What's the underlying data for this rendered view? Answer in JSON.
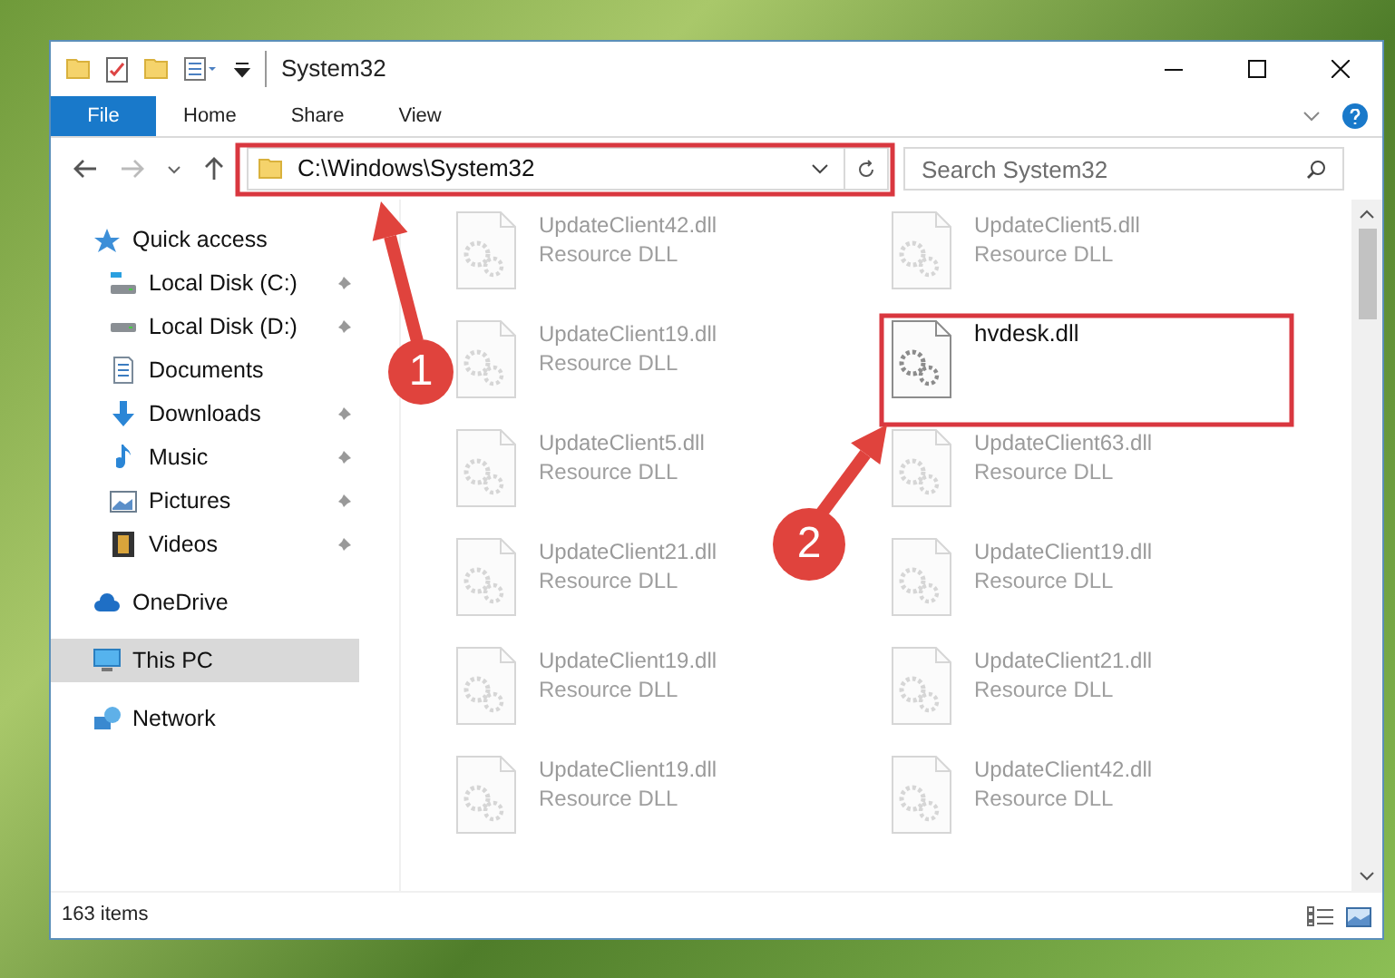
{
  "window": {
    "title": "System32"
  },
  "ribbon_tabs": [
    {
      "label": "File",
      "kind": "file",
      "selected": false
    },
    {
      "label": "Home",
      "kind": "tab",
      "selected": false
    },
    {
      "label": "Share",
      "kind": "tab",
      "selected": false
    },
    {
      "label": "View",
      "kind": "tab",
      "selected": false
    }
  ],
  "address_bar": {
    "path": "C:\\Windows\\System32"
  },
  "search": {
    "placeholder": "Search System32"
  },
  "sidebar": {
    "items": [
      {
        "label": "Quick access",
        "selected": false,
        "children": [
          {
            "label": "Local Disk (C:)",
            "pinned": true,
            "selected": false
          },
          {
            "label": "Local Disk (D:)",
            "pinned": true,
            "selected": false
          },
          {
            "label": "Documents",
            "pinned": false,
            "selected": false
          },
          {
            "label": "Downloads",
            "pinned": true,
            "selected": false
          },
          {
            "label": "Music",
            "pinned": true,
            "selected": false
          },
          {
            "label": "Pictures",
            "pinned": true,
            "selected": false
          },
          {
            "label": "Videos",
            "pinned": true,
            "selected": false
          }
        ]
      },
      {
        "label": "OneDrive",
        "selected": false
      },
      {
        "label": "This PC",
        "selected": true
      },
      {
        "label": "Network",
        "selected": false
      }
    ]
  },
  "files": [
    {
      "name": "UpdateClient42.dll",
      "type": "Resource DLL",
      "blurred": true
    },
    {
      "name": "UpdateClient5.dll",
      "type": "Resource DLL",
      "blurred": true
    },
    {
      "name": "UpdateClient19.dll",
      "type": "Resource DLL",
      "blurred": true
    },
    {
      "name": "hvdesk.dll",
      "blurred": false
    },
    {
      "name": "UpdateClient5.dll",
      "type": "Resource DLL",
      "blurred": true
    },
    {
      "name": "UpdateClient63.dll",
      "type": "Resource DLL",
      "blurred": true
    },
    {
      "name": "UpdateClient21.dll",
      "type": "Resource DLL",
      "blurred": true
    },
    {
      "name": "UpdateClient19.dll",
      "type": "Resource DLL",
      "blurred": true
    },
    {
      "name": "UpdateClient19.dll",
      "type": "Resource DLL",
      "blurred": true
    },
    {
      "name": "UpdateClient21.dll",
      "type": "Resource DLL",
      "blurred": true
    },
    {
      "name": "UpdateClient19.dll",
      "type": "Resource DLL",
      "blurred": true
    },
    {
      "name": "UpdateClient42.dll",
      "type": "Resource DLL",
      "blurred": true
    }
  ],
  "status_bar": {
    "item_count": "163 items"
  },
  "annotations": [
    {
      "number": "1"
    },
    {
      "number": "2"
    }
  ]
}
